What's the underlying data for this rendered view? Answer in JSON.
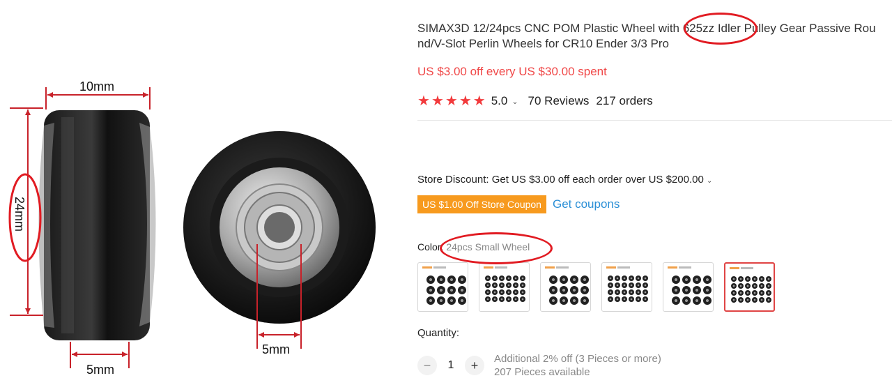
{
  "image": {
    "dims": {
      "width": "10mm",
      "height": "24mm",
      "bore": "5mm",
      "side_width": "5mm"
    }
  },
  "product": {
    "title_line1": "SIMAX3D 12/24pcs CNC POM Plastic Wheel with 625zz Idler Pulley Gear Passive Rou",
    "title_line2": "nd/V-Slot Perlin Wheels for CR10 Ender 3/3 Pro",
    "promo": "US $3.00 off every US $30.00 spent",
    "rating": "5.0",
    "reviews": "70 Reviews",
    "orders": "217 orders"
  },
  "store": {
    "discount": "Store Discount: Get US $3.00 off each order over US $200.00",
    "coupon_tag": "US $1.00 Off Store Coupon",
    "get_coupons": "Get coupons"
  },
  "variant": {
    "label": "Color:",
    "selected": "24pcs Small Wheel",
    "swatch_count": 6,
    "selected_index": 5
  },
  "quantity": {
    "label": "Quantity:",
    "value": "1",
    "minus": "−",
    "plus": "+",
    "note1": "Additional 2% off (3 Pieces or more)",
    "note2": "207 Pieces available"
  },
  "colors": {
    "accent_red": "#f04848",
    "coupon_orange": "#f79a1e",
    "link_blue": "#2b8fd6",
    "annotation": "#e11b22"
  }
}
